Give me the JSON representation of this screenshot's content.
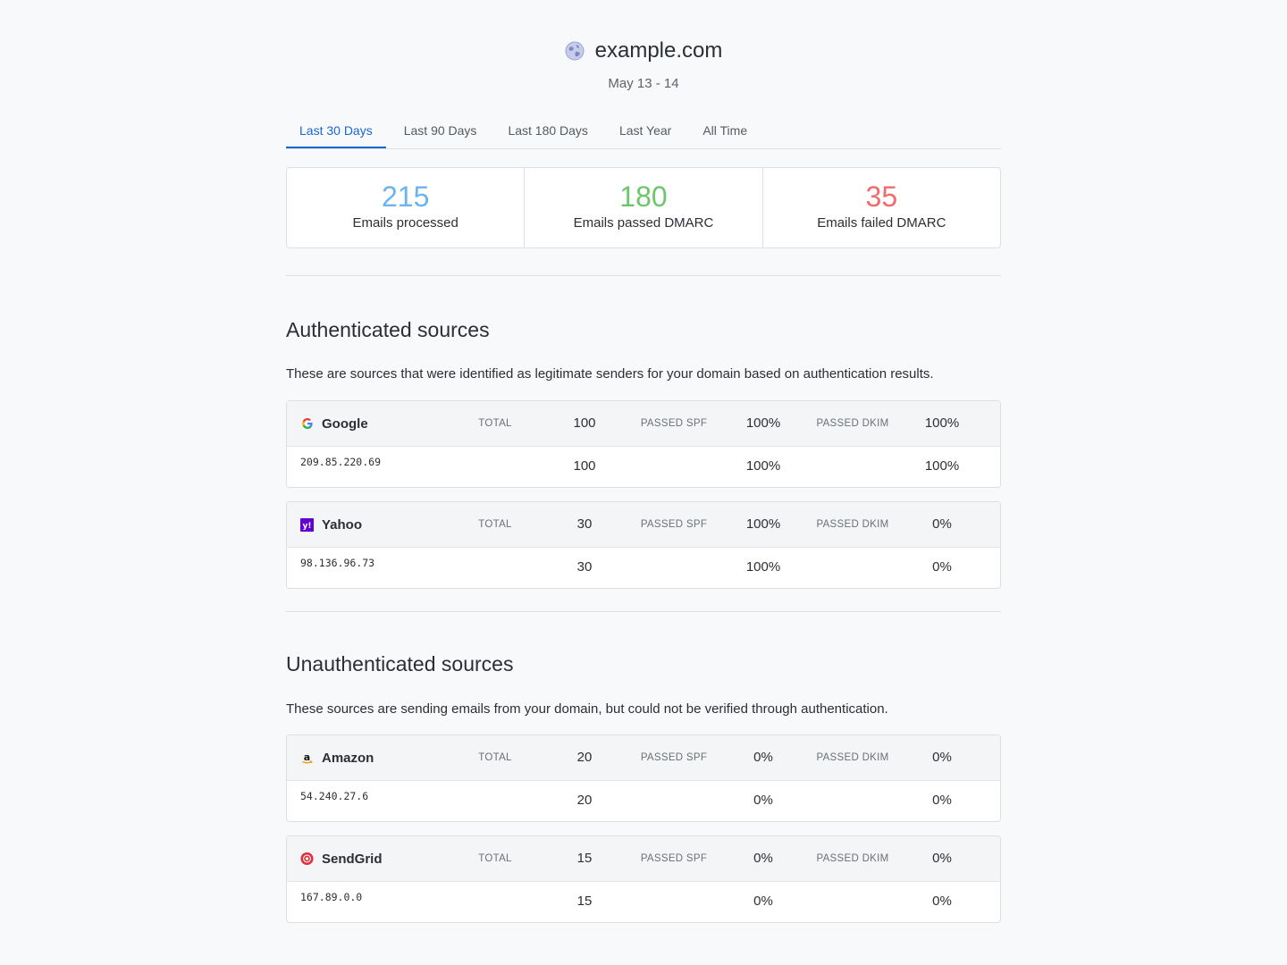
{
  "header": {
    "domain": "example.com",
    "globe_icon": "globe-icon",
    "date_range": "May 13 - 14"
  },
  "tabs": [
    {
      "label": "Last 30 Days",
      "active": true
    },
    {
      "label": "Last 90 Days",
      "active": false
    },
    {
      "label": "Last 180 Days",
      "active": false
    },
    {
      "label": "Last Year",
      "active": false
    },
    {
      "label": "All Time",
      "active": false
    }
  ],
  "stats": [
    {
      "value": "215",
      "label": "Emails processed",
      "color": "#6cb4ee"
    },
    {
      "value": "180",
      "label": "Emails passed DMARC",
      "color": "#6cc66c"
    },
    {
      "value": "35",
      "label": "Emails failed DMARC",
      "color": "#f26b6b"
    }
  ],
  "columns": {
    "total": "TOTAL",
    "spf": "PASSED SPF",
    "dkim": "PASSED DKIM"
  },
  "authenticated": {
    "title": "Authenticated sources",
    "description": "These are sources that were identified as legitimate senders for your domain based on authentication results.",
    "sources": [
      {
        "name": "Google",
        "icon": "google-icon",
        "total": "100",
        "spf": "100%",
        "dkim": "100%",
        "rows": [
          {
            "ip": "209.85.220.69",
            "total": "100",
            "spf": "100%",
            "dkim": "100%"
          }
        ]
      },
      {
        "name": "Yahoo",
        "icon": "yahoo-icon",
        "total": "30",
        "spf": "100%",
        "dkim": "0%",
        "rows": [
          {
            "ip": "98.136.96.73",
            "total": "30",
            "spf": "100%",
            "dkim": "0%"
          }
        ]
      }
    ]
  },
  "unauthenticated": {
    "title": "Unauthenticated sources",
    "description": "These sources are sending emails from your domain, but could not be verified through authentication.",
    "sources": [
      {
        "name": "Amazon",
        "icon": "amazon-icon",
        "total": "20",
        "spf": "0%",
        "dkim": "0%",
        "rows": [
          {
            "ip": "54.240.27.6",
            "total": "20",
            "spf": "0%",
            "dkim": "0%"
          }
        ]
      },
      {
        "name": "SendGrid",
        "icon": "sendgrid-icon",
        "total": "15",
        "spf": "0%",
        "dkim": "0%",
        "rows": [
          {
            "ip": "167.89.0.0",
            "total": "15",
            "spf": "0%",
            "dkim": "0%"
          }
        ]
      }
    ]
  }
}
